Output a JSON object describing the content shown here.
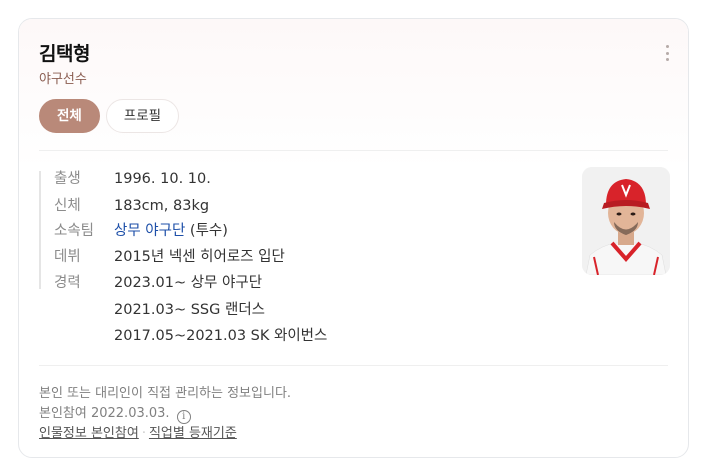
{
  "profile": {
    "name": "김택형",
    "subtitle": "야구선수"
  },
  "tabs": [
    {
      "label": "전체",
      "active": true
    },
    {
      "label": "프로필",
      "active": false
    }
  ],
  "info": [
    {
      "label": "출생",
      "value": "1996. 10. 10."
    },
    {
      "label": "신체",
      "value": "183cm, 83kg"
    },
    {
      "label": "소속팀",
      "value_link": "상무 야구단",
      "value_suffix": " (투수)"
    },
    {
      "label": "데뷔",
      "value": "2015년 넥센 히어로즈 입단"
    },
    {
      "label": "경력",
      "value": "2023.01~ 상무 야구단"
    },
    {
      "label": "",
      "value": "2021.03~ SSG 랜더스"
    },
    {
      "label": "",
      "value": "2017.05~2021.03 SK 와이번스"
    }
  ],
  "footer": {
    "notice": "본인 또는 대리인이 직접 관리하는 정보입니다.",
    "participation": "본인참여 2022.03.03.",
    "info_icon": "i",
    "link1": "인물정보 본인참여",
    "separator": "·",
    "link2": "직업별 등재기준"
  },
  "icons": {
    "more": "more-vertical-icon",
    "info": "info-circle-icon"
  },
  "colors": {
    "accent": "#b98979",
    "subtitle": "#8a5c50",
    "link": "#1d4fa8"
  }
}
